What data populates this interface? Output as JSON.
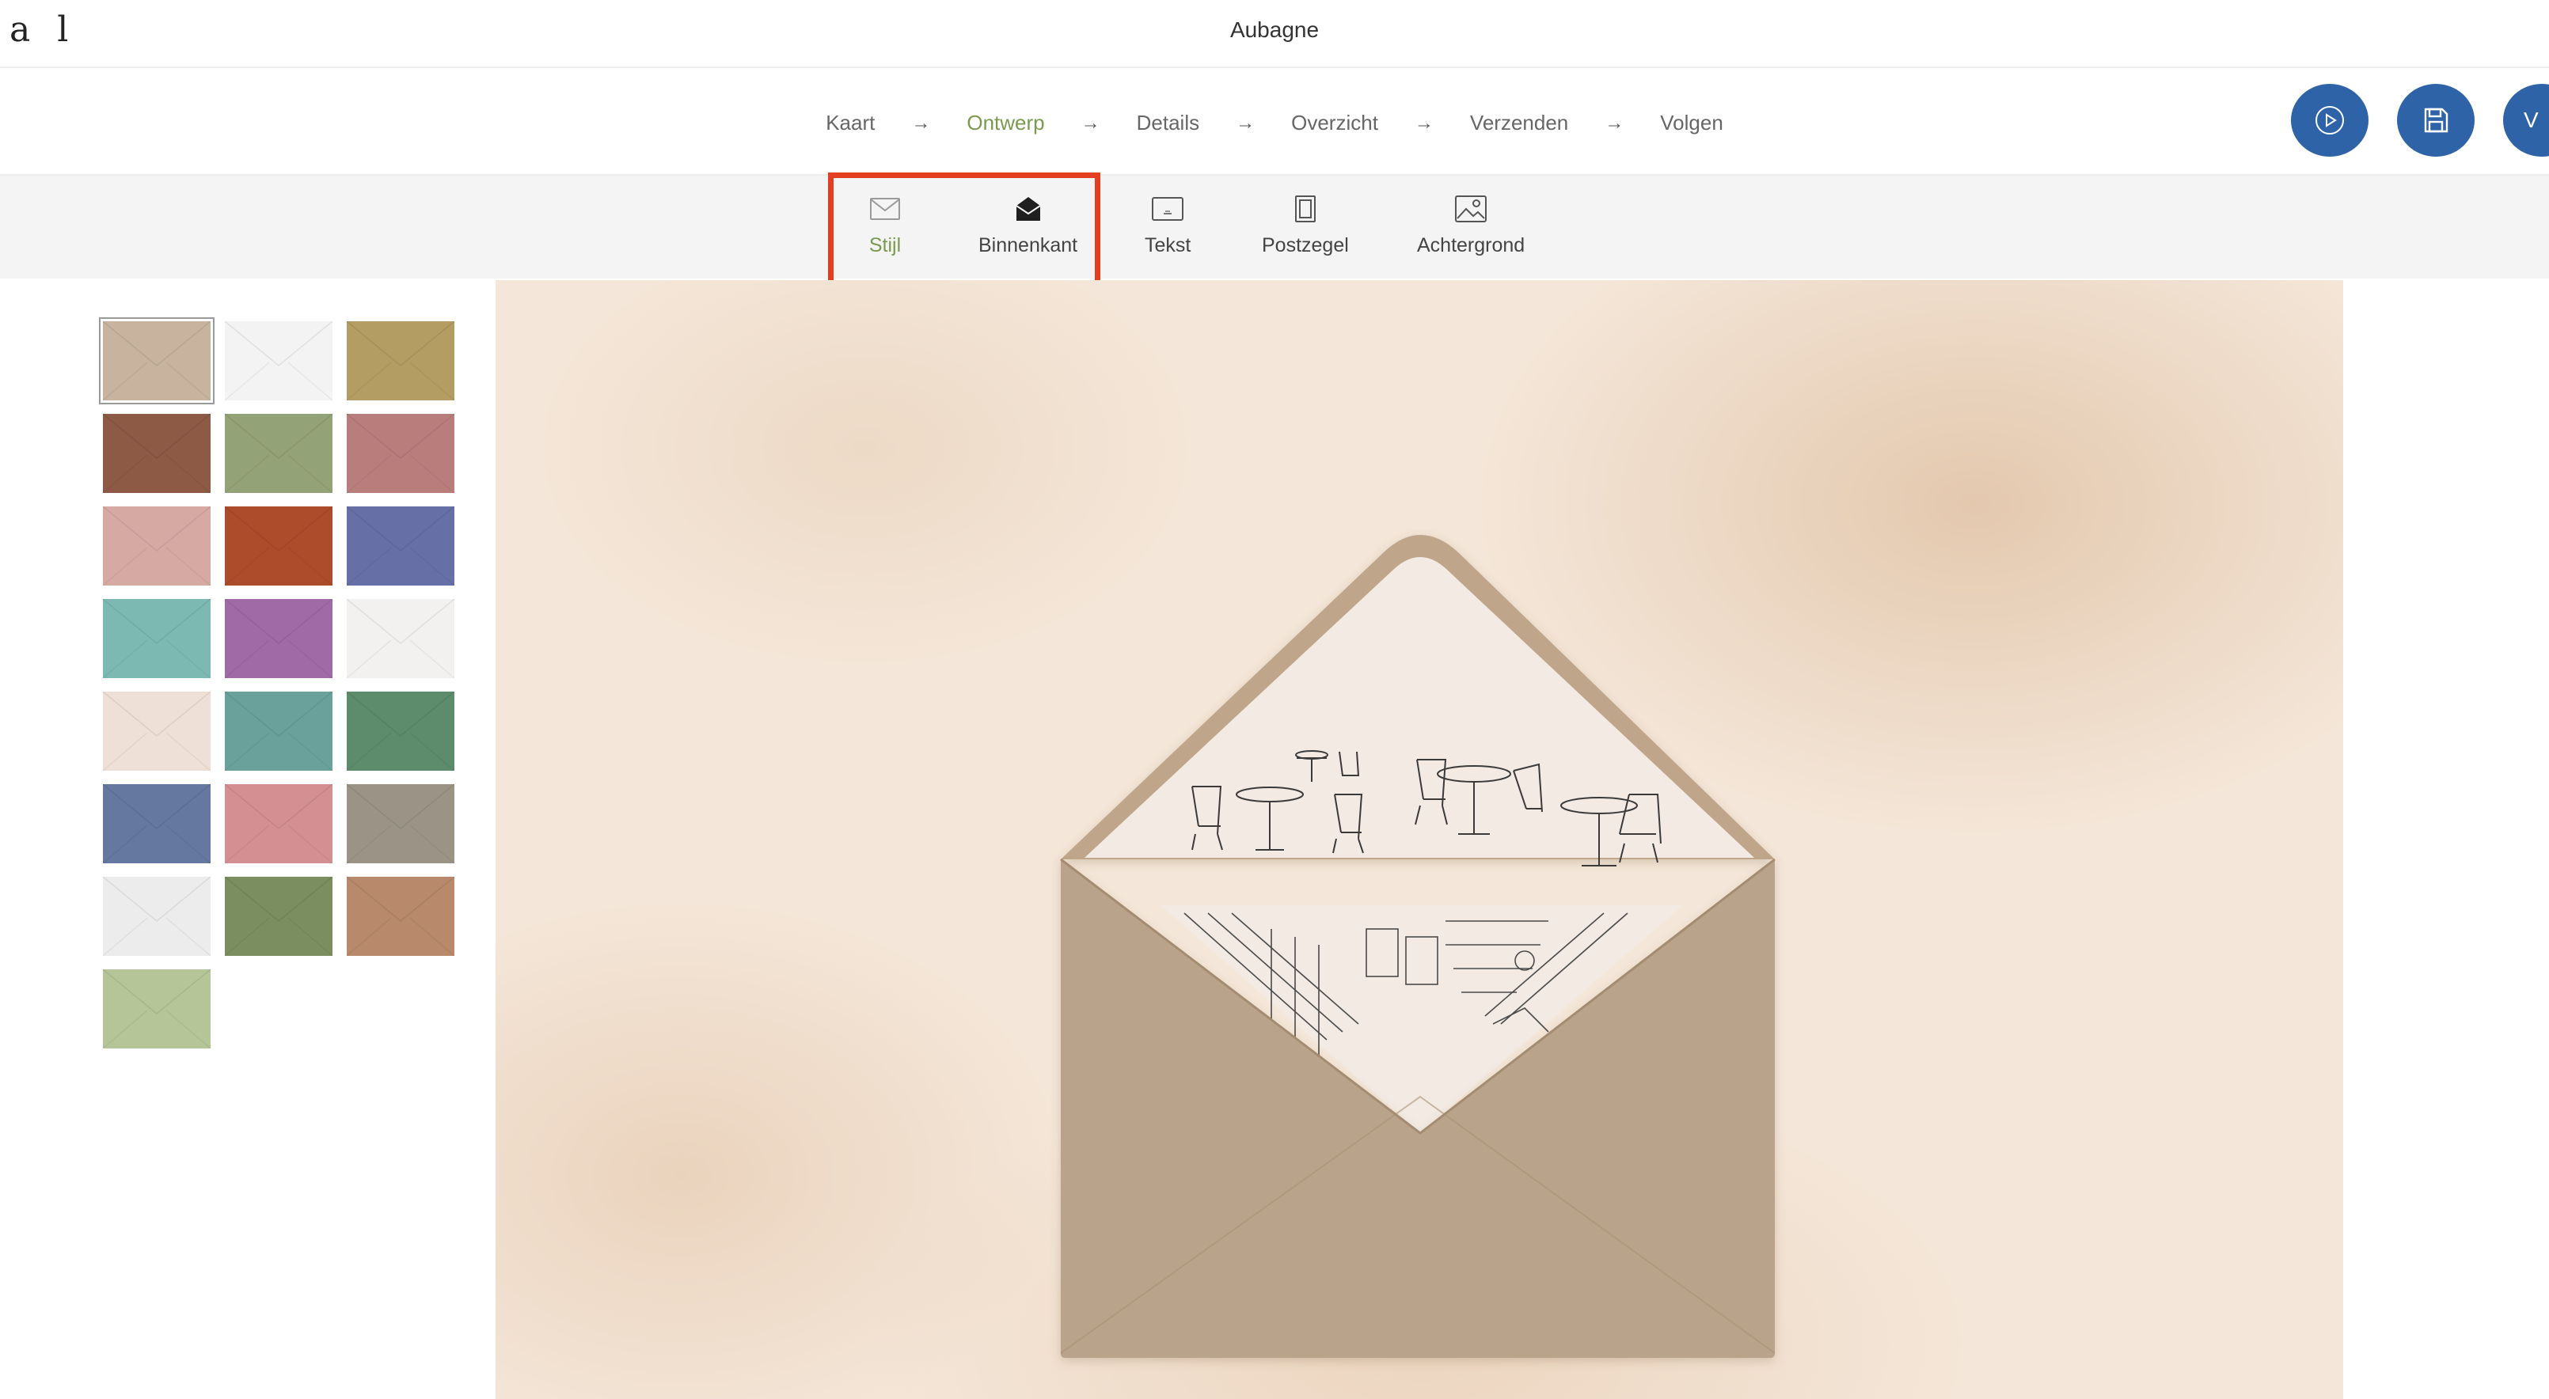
{
  "logo": "a l",
  "title": "Aubagne",
  "steps": [
    {
      "label": "Kaart",
      "active": false
    },
    {
      "label": "Ontwerp",
      "active": true
    },
    {
      "label": "Details",
      "active": false
    },
    {
      "label": "Overzicht",
      "active": false
    },
    {
      "label": "Verzenden",
      "active": false
    },
    {
      "label": "Volgen",
      "active": false
    }
  ],
  "step_arrow": "→",
  "actions": {
    "preview_icon": "play-circle-icon",
    "save_icon": "save-icon",
    "next_partial_label": "V"
  },
  "toolbar": {
    "tools": [
      {
        "label": "Stijl",
        "icon": "envelope-icon",
        "active": true
      },
      {
        "label": "Binnenkant",
        "icon": "envelope-open-icon",
        "active": false
      },
      {
        "label": "Tekst",
        "icon": "text-card-icon",
        "active": false
      },
      {
        "label": "Postzegel",
        "icon": "stamp-icon",
        "active": false
      },
      {
        "label": "Achtergrond",
        "icon": "image-icon",
        "active": false
      }
    ]
  },
  "colors": {
    "accent_green": "#7a9a4f",
    "button_blue": "#2f63a8",
    "highlight_red": "#e23e1f"
  },
  "swatches": [
    {
      "color": "#c7b39e",
      "selected": true
    },
    {
      "color": "#f3f3f3",
      "selected": false
    },
    {
      "color": "#b39d62",
      "selected": false
    },
    {
      "color": "#8d5a45",
      "selected": false
    },
    {
      "color": "#94a277",
      "selected": false
    },
    {
      "color": "#b97e7c",
      "selected": false
    },
    {
      "color": "#d6aaa3",
      "selected": false
    },
    {
      "color": "#ad4c2b",
      "selected": false
    },
    {
      "color": "#6670a6",
      "selected": false
    },
    {
      "color": "#7db9b3",
      "selected": false
    },
    {
      "color": "#a06aa6",
      "selected": false
    },
    {
      "color": "#f3f1ef",
      "selected": false
    },
    {
      "color": "#eee0d6",
      "selected": false
    },
    {
      "color": "#6aa29b",
      "selected": false
    },
    {
      "color": "#5c8c6c",
      "selected": false
    },
    {
      "color": "#6478a0",
      "selected": false
    },
    {
      "color": "#d48f93",
      "selected": false
    },
    {
      "color": "#9b9486",
      "selected": false
    },
    {
      "color": "#ececec",
      "selected": false
    },
    {
      "color": "#7b8e5f",
      "selected": false
    },
    {
      "color": "#b8896a",
      "selected": false
    },
    {
      "color": "#b5c597",
      "selected": false
    }
  ]
}
